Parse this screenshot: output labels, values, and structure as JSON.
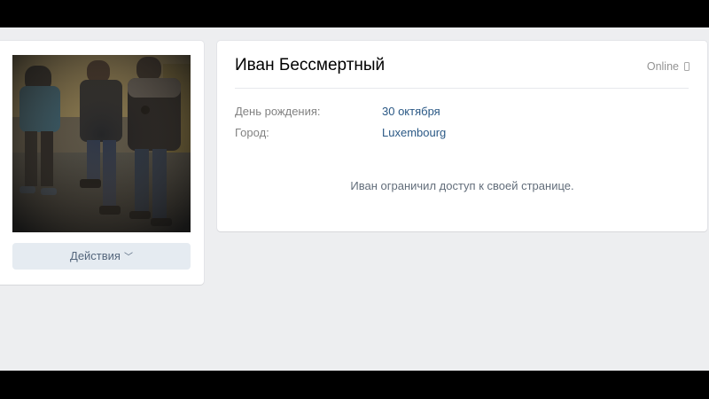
{
  "profile": {
    "name": "Иван Бессмертный",
    "status": "Online",
    "status_icon": "mobile-phone-icon",
    "birthday_label": "День рождения:",
    "birthday_value": "30 октября",
    "city_label": "Город:",
    "city_value": "Luxembourg",
    "restricted_message": "Иван ограничил доступ к своей странице."
  },
  "sidebar": {
    "avatar_alt": "profile-photo",
    "actions_label": "Действия",
    "actions_icon": "chevron-down-icon"
  },
  "colors": {
    "page_bg": "#edeef0",
    "link": "#2a5885",
    "button_bg": "#e5ebf1",
    "button_text": "#55677d",
    "muted": "#828282"
  }
}
